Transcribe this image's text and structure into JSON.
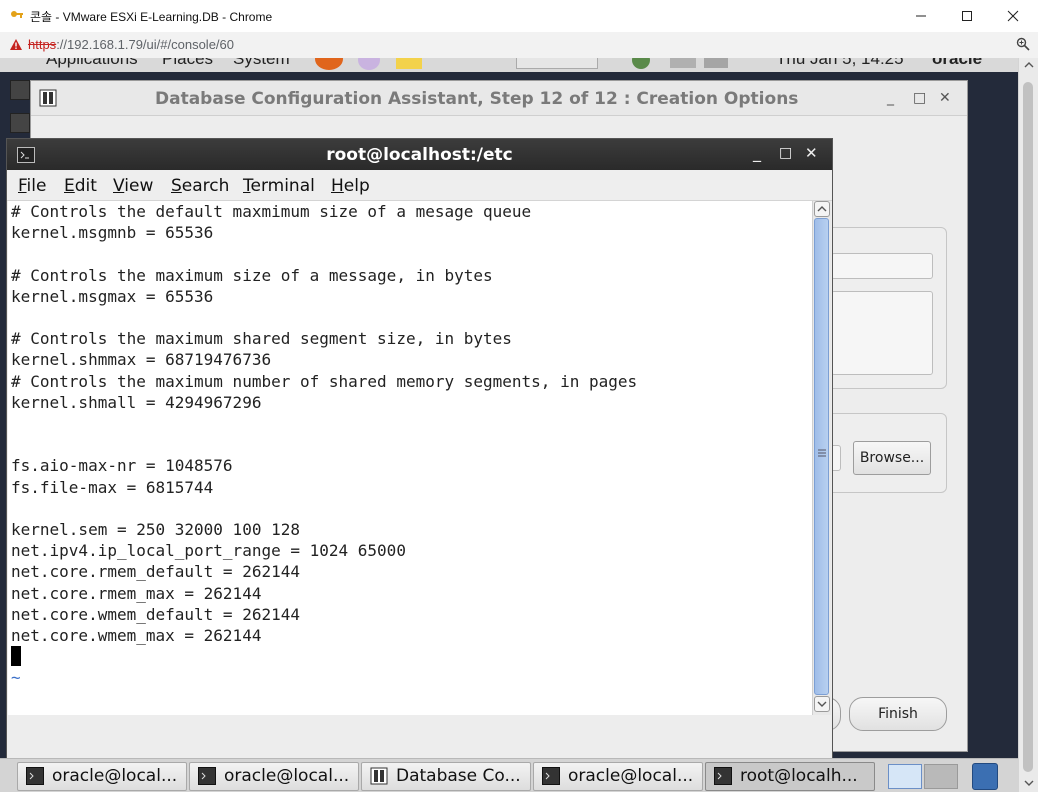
{
  "browser": {
    "title": "콘솔 - VMware ESXi E-Learning.DB - Chrome",
    "url_scheme": "https",
    "url_rest": "://192.168.1.79/ui/#/console/60"
  },
  "gnome_panel": {
    "items": [
      "Applications",
      "Places",
      "System"
    ],
    "clock": "Thu Jan  5, 14:25",
    "user": "oracle"
  },
  "dbca": {
    "title": "Database Configuration Assistant, Step 12 of 12 : Creation Options",
    "browse_label": "Browse...",
    "finish_label": "Finish"
  },
  "terminal": {
    "title": "root@localhost:/etc",
    "menu": [
      "File",
      "Edit",
      "View",
      "Search",
      "Terminal",
      "Help"
    ],
    "lines": [
      "# Controls the default maxmimum size of a mesage queue",
      "kernel.msgmnb = 65536",
      "",
      "# Controls the maximum size of a message, in bytes",
      "kernel.msgmax = 65536",
      "",
      "# Controls the maximum shared segment size, in bytes",
      "kernel.shmmax = 68719476736",
      "# Controls the maximum number of shared memory segments, in pages",
      "kernel.shmall = 4294967296",
      "",
      "",
      "fs.aio-max-nr = 1048576",
      "fs.file-max = 6815744",
      "",
      "kernel.sem = 250 32000 100 128",
      "net.ipv4.ip_local_port_range = 1024 65000",
      "net.core.rmem_default = 262144",
      "net.core.rmem_max = 262144",
      "net.core.wmem_default = 262144",
      "net.core.wmem_max = 262144"
    ],
    "tilde": "~"
  },
  "taskbar": {
    "tasks": [
      {
        "label": "oracle@local...",
        "icon": "terminal-icon"
      },
      {
        "label": "oracle@local...",
        "icon": "terminal-icon"
      },
      {
        "label": "Database Co...",
        "icon": "database-icon"
      },
      {
        "label": "oracle@local...",
        "icon": "terminal-icon"
      },
      {
        "label": "root@localh...",
        "icon": "terminal-icon",
        "active": true
      }
    ]
  }
}
